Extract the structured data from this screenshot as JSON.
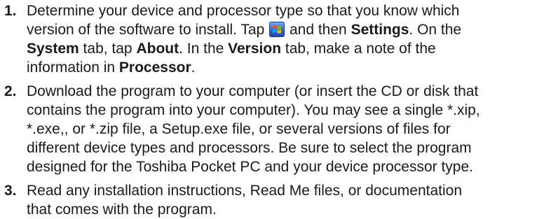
{
  "steps": [
    {
      "number": "1.",
      "lines": [
        [
          "Determine your device and processor type so that you know which"
        ],
        [
          "version of the software to install. Tap ",
          {
            "icon": "windows-start-flag-icon"
          },
          " and then ",
          {
            "b": "Settings"
          },
          ". On the"
        ],
        [
          {
            "b": "System"
          },
          " tab, tap ",
          {
            "b": "About"
          },
          ". In the ",
          {
            "b": "Version"
          },
          " tab, make a note of the"
        ],
        [
          "information in ",
          {
            "b": "Processor"
          },
          "."
        ]
      ]
    },
    {
      "number": "2.",
      "lines": [
        [
          "Download the program to your computer (or insert the CD or disk that"
        ],
        [
          "contains the program into your computer). You may see a single *.xip,"
        ],
        [
          "*.exe,, or *.zip file, a Setup.exe file, or several versions of files for"
        ],
        [
          "different device types and processors. Be sure to select the program"
        ],
        [
          "designed for the Toshiba Pocket PC and your device processor type."
        ]
      ]
    },
    {
      "number": "3.",
      "lines": [
        [
          "Read any installation instructions, Read Me files, or documentation"
        ],
        [
          "that comes with the program."
        ]
      ]
    }
  ]
}
